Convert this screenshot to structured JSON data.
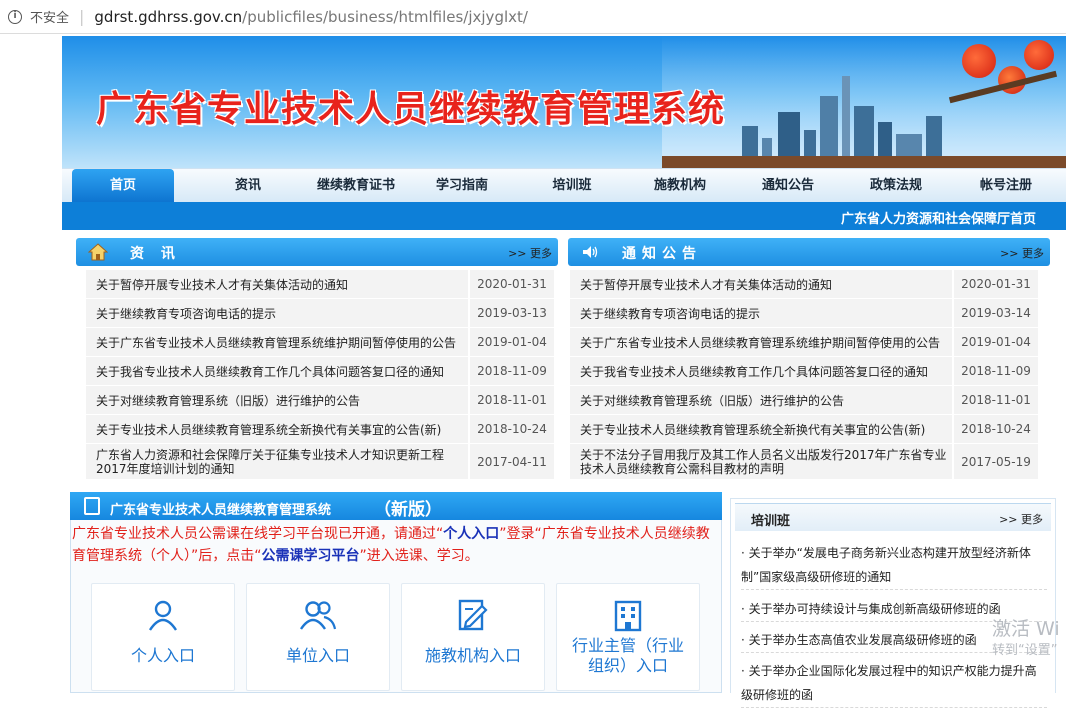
{
  "browser": {
    "insecure_label": "不安全",
    "url_host": "gdrst.gdhrss.gov.cn",
    "url_path": "/publicfiles/business/htmlfiles/jxjyglxt/"
  },
  "banner": {
    "title": "广东省专业技术人员继续教育管理系统"
  },
  "nav": {
    "items": [
      "首页",
      "资讯",
      "继续教育证书",
      "学习指南",
      "培训班",
      "施教机构",
      "通知公告",
      "政策法规",
      "帐号注册"
    ],
    "dept_link": "广东省人力资源和社会保障厅首页"
  },
  "news": {
    "title": "资  讯",
    "more": ">> 更多",
    "rows": [
      {
        "title": "关于暂停开展专业技术人才有关集体活动的通知",
        "date": "2020-01-31"
      },
      {
        "title": "关于继续教育专项咨询电话的提示",
        "date": "2019-03-13"
      },
      {
        "title": "关于广东省专业技术人员继续教育管理系统维护期间暂停使用的公告",
        "date": "2019-01-04"
      },
      {
        "title": "关于我省专业技术人员继续教育工作几个具体问题答复口径的通知",
        "date": "2018-11-09"
      },
      {
        "title": "关于对继续教育管理系统（旧版）进行维护的公告",
        "date": "2018-11-01"
      },
      {
        "title": "关于专业技术人员继续教育管理系统全新换代有关事宜的公告(新)",
        "date": "2018-10-24"
      },
      {
        "title": "广东省人力资源和社会保障厅关于征集专业技术人才知识更新工程2017年度培训计划的通知",
        "date": "2017-04-11"
      }
    ]
  },
  "notice": {
    "title": "通知公告",
    "more": ">> 更多",
    "rows": [
      {
        "title": "关于暂停开展专业技术人才有关集体活动的通知",
        "date": "2020-01-31"
      },
      {
        "title": "关于继续教育专项咨询电话的提示",
        "date": "2019-03-14"
      },
      {
        "title": "关于广东省专业技术人员继续教育管理系统维护期间暂停使用的公告",
        "date": "2019-01-04"
      },
      {
        "title": "关于我省专业技术人员继续教育工作几个具体问题答复口径的通知",
        "date": "2018-11-09"
      },
      {
        "title": "关于对继续教育管理系统（旧版）进行维护的公告",
        "date": "2018-11-01"
      },
      {
        "title": "关于专业技术人员继续教育管理系统全新换代有关事宜的公告(新)",
        "date": "2018-10-24"
      },
      {
        "title": "关于不法分子冒用我厅及其工作人员名义出版发行2017年广东省专业技术人员继续教育公需科目教材的声明",
        "date": "2017-05-19"
      }
    ]
  },
  "newsys": {
    "title": "广东省专业技术人员继续教育管理系统",
    "title_suffix": "（新版）",
    "notice_p1": "广东省专业技术人员公需课在线学习平台现已开通，请通过“",
    "notice_b1": "个人入口",
    "notice_p2": "”登录“广东省专业技术人员继续教育管理系统（个人）”后，点击“",
    "notice_b2": "公需课学习平台",
    "notice_p3": "”进入选课、学习。",
    "entries": [
      {
        "label": "个人入口"
      },
      {
        "label": "单位入口"
      },
      {
        "label": "施教机构入口"
      },
      {
        "label": "行业主管（行业组织）入口"
      }
    ]
  },
  "training": {
    "title": "培训班",
    "more": ">> 更多",
    "items": [
      "· 关于举办“发展电子商务新兴业态构建开放型经济新体制”国家级高级研修班的通知",
      "· 关于举办可持续设计与集成创新高级研修班的函",
      "· 关于举办生态高值农业发展高级研修班的函",
      "· 关于举办企业国际化发展过程中的知识产权能力提升高级研修班的函"
    ]
  },
  "watermark": {
    "line1": "激活 Wi",
    "line2": "转到“设置”"
  }
}
